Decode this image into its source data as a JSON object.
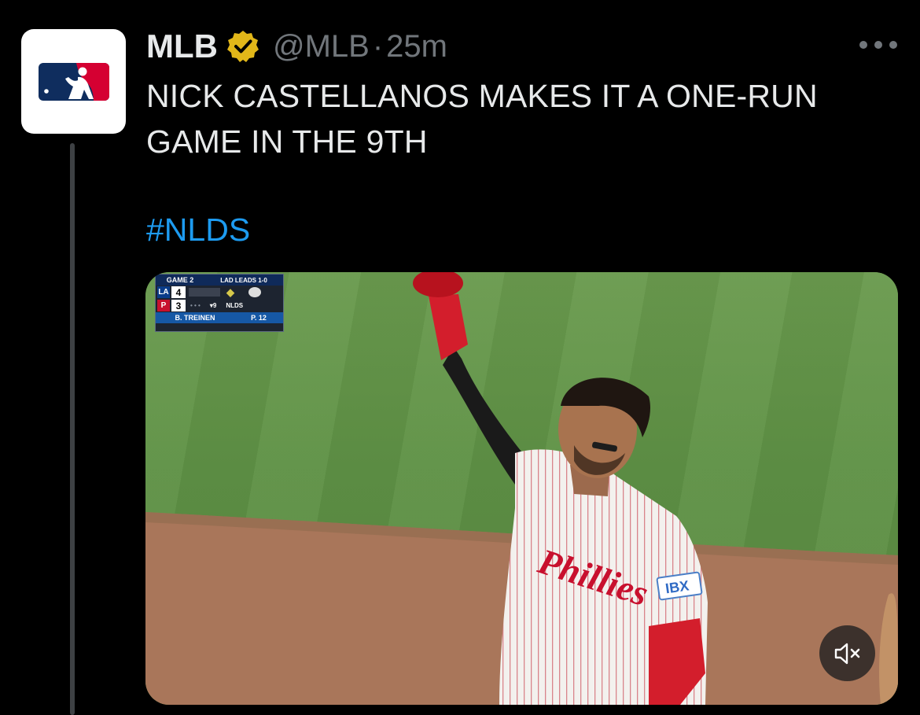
{
  "tweet": {
    "author_name": "MLB",
    "handle": "@MLB",
    "separator": "·",
    "time": "25m",
    "text_line1": "NICK CASTELLANOS MAKES IT A ONE-RUN",
    "text_line2": "GAME IN THE 9TH",
    "hashtag": "#NLDS",
    "avatar_icon": "mlb-logo-icon",
    "badge_icon": "verified-gold-badge-icon",
    "more_icon": "more-options-icon"
  },
  "video": {
    "mute_icon": "volume-muted-icon",
    "scorebug": {
      "game": "GAME 2",
      "series": "LAD LEADS 1-0",
      "team1": "LA",
      "team1_score": "4",
      "team2": "P",
      "team2_score": "3",
      "inning": "▾9",
      "network": "NLDS",
      "pitcher": "B. TREINEN",
      "pitch_count": "P. 12"
    },
    "jersey_text": "Phillies",
    "patch_text": "IBX"
  },
  "colors": {
    "background": "#000000",
    "text": "#e7e9ea",
    "secondary": "#71767b",
    "link": "#1d9bf0",
    "badge": "#e2b719",
    "thread_line": "#3e4144"
  }
}
